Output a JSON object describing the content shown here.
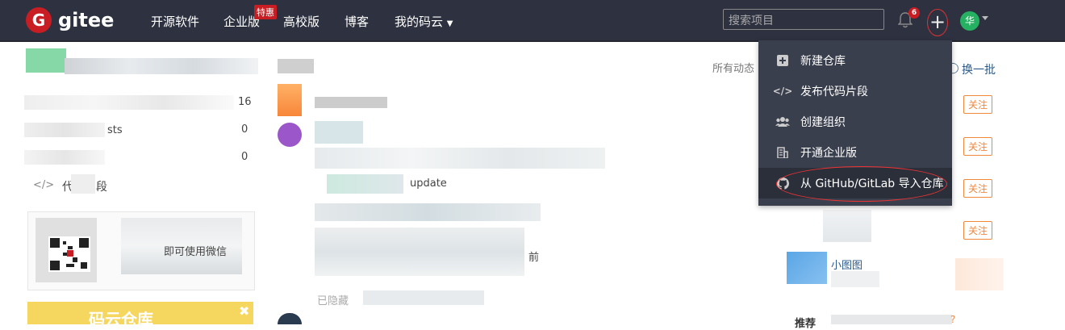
{
  "navbar": {
    "logo_text": "gitee",
    "items": [
      "开源软件",
      "企业版",
      "高校版",
      "博客",
      "我的码云"
    ],
    "special_badge": "特惠",
    "search_placeholder": "搜索项目",
    "notification_count": "6",
    "avatar_text": "华"
  },
  "dropdown": {
    "items": [
      {
        "label": "新建仓库",
        "icon": "plus-square-icon"
      },
      {
        "label": "发布代码片段",
        "icon": "code-icon"
      },
      {
        "label": "创建组织",
        "icon": "group-icon"
      },
      {
        "label": "开通企业版",
        "icon": "building-icon"
      },
      {
        "label": "从 GitHub/GitLab 导入仓库",
        "icon": "github-icon"
      }
    ]
  },
  "page": {
    "feed_filter": "所有动态",
    "refresh": "换一批",
    "follow_label": "关注",
    "sidebar_count_1": "16",
    "sidebar_count_2": "0",
    "sidebar_count_3": "0",
    "sidebar_snippet_tail": "段",
    "sidebar_snippet_head": "代",
    "feed_update": "update",
    "feed_time_fragment": "前",
    "user_name": "小图图",
    "hidden_fragment": "已隐藏",
    "promo_title": "码云仓库",
    "qr_text_1": "即可使用微信",
    "sidebar_tests": "sts",
    "bottom_fragment": "推荐"
  },
  "colors": {
    "navbar_bg": "#2e3240",
    "brand_red": "#c71d23",
    "dropdown_bg": "#3a3f4d",
    "follow_orange": "#f0883e"
  }
}
